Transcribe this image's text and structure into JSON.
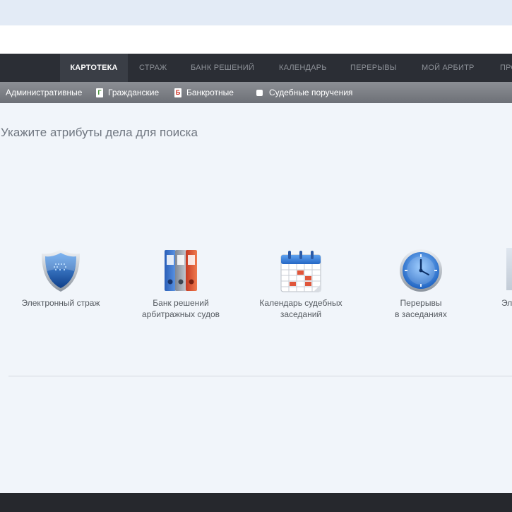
{
  "nav": {
    "items": [
      {
        "label": "КАРТОТЕКА",
        "active": true
      },
      {
        "label": "СТРАЖ"
      },
      {
        "label": "БАНК РЕШЕНИЙ"
      },
      {
        "label": "КАЛЕНДАРЬ"
      },
      {
        "label": "ПЕРЕРЫВЫ"
      },
      {
        "label": "МОЙ АРБИТР"
      },
      {
        "label": "ПРО"
      }
    ]
  },
  "subnav": {
    "items": [
      {
        "label": "Административные"
      },
      {
        "label": "Гражданские",
        "badge": "Г"
      },
      {
        "label": "Банкротные",
        "badge": "Б"
      },
      {
        "label": "Судебные поручения"
      }
    ]
  },
  "main": {
    "heading": "Укажите атрибуты дела для поиска",
    "tiles": [
      {
        "line1": "Электронный страж",
        "line2": "",
        "icon": "shield-icon"
      },
      {
        "line1": "Банк решений",
        "line2": "арбитражных судов",
        "icon": "binders-icon"
      },
      {
        "line1": "Календарь судебных",
        "line2": "заседаний",
        "icon": "calendar-icon"
      },
      {
        "line1": "Перерывы",
        "line2": "в заседаниях",
        "icon": "clock-icon"
      },
      {
        "line1": "Эл",
        "line2": "",
        "icon": ""
      }
    ]
  },
  "colors": {
    "nav_bg": "#2b2e35",
    "subnav_bg": "#7d8087",
    "page_bg": "#f1f5fa",
    "accent_blue": "#3a7fd0"
  }
}
